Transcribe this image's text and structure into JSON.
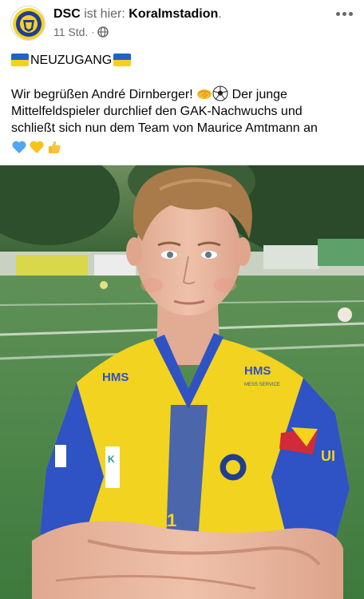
{
  "post": {
    "page_name": "DSC",
    "verb": "ist hier:",
    "place": "Koralmstadion",
    "place_suffix": ".",
    "time": "11 Std.",
    "dot": "·",
    "audience_icon": "globe-icon",
    "more_icon": "more-horizontal-icon",
    "headline": "NEUZUGANG",
    "message_line1": "Wir begrüßen André Dirnberger!",
    "message_line1_end": "Der junge",
    "message_line2": "Mittelfeldspieler durchlief den GAK-Nachwuchs und",
    "message_line3": "schließt sich nun dem Team von Maurice Amtmann an",
    "emojis": [
      "handshake-icon",
      "soccer-ball-icon",
      "blue-heart-icon",
      "yellow-heart-icon",
      "thumbs-up-icon"
    ]
  },
  "photo": {
    "sponsor_chest": "HMS",
    "sponsor_chest_sub": "MESS SERVICE",
    "sponsor_sleeve_left": "K",
    "sponsor_sleeve_right": "UI",
    "shirt_number": "11"
  },
  "colors": {
    "text": "#050505",
    "secondary_text": "#65676b",
    "jersey_yellow": "#f2d31f",
    "jersey_blue": "#2f52c4",
    "grass": "#4f8a4c"
  }
}
